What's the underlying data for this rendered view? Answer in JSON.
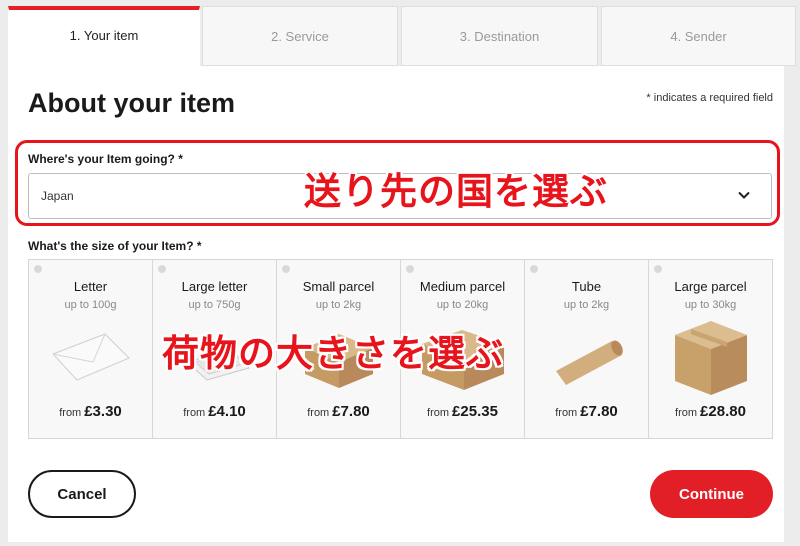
{
  "tabs": [
    {
      "label": "1. Your item",
      "active": true
    },
    {
      "label": "2. Service",
      "active": false
    },
    {
      "label": "3. Destination",
      "active": false
    },
    {
      "label": "4. Sender",
      "active": false
    }
  ],
  "page": {
    "title": "About your item",
    "required_note": "* indicates a required field"
  },
  "destination": {
    "label": "Where's your Item going? *",
    "value": "Japan"
  },
  "size": {
    "label": "What's the size of your Item? *",
    "options": [
      {
        "name": "Letter",
        "weight": "up to 100g",
        "from": "from",
        "price": "£3.30",
        "icon": "envelope-icon"
      },
      {
        "name": "Large letter",
        "weight": "up to 750g",
        "from": "from",
        "price": "£4.10",
        "icon": "large-letter-icon"
      },
      {
        "name": "Small parcel",
        "weight": "up to 2kg",
        "from": "from",
        "price": "£7.80",
        "icon": "small-box-icon"
      },
      {
        "name": "Medium parcel",
        "weight": "up to 20kg",
        "from": "from",
        "price": "£25.35",
        "icon": "medium-box-icon"
      },
      {
        "name": "Tube",
        "weight": "up to 2kg",
        "from": "from",
        "price": "£7.80",
        "icon": "tube-icon"
      },
      {
        "name": "Large parcel",
        "weight": "up to 30kg",
        "from": "from",
        "price": "£28.80",
        "icon": "large-box-icon"
      }
    ]
  },
  "annotations": {
    "destination_note": "送り先の国を選ぶ",
    "size_note": "荷物の大きさを選ぶ"
  },
  "buttons": {
    "cancel": "Cancel",
    "continue": "Continue"
  },
  "colors": {
    "accent": "#e21f26",
    "annotation": "#e8141c"
  }
}
